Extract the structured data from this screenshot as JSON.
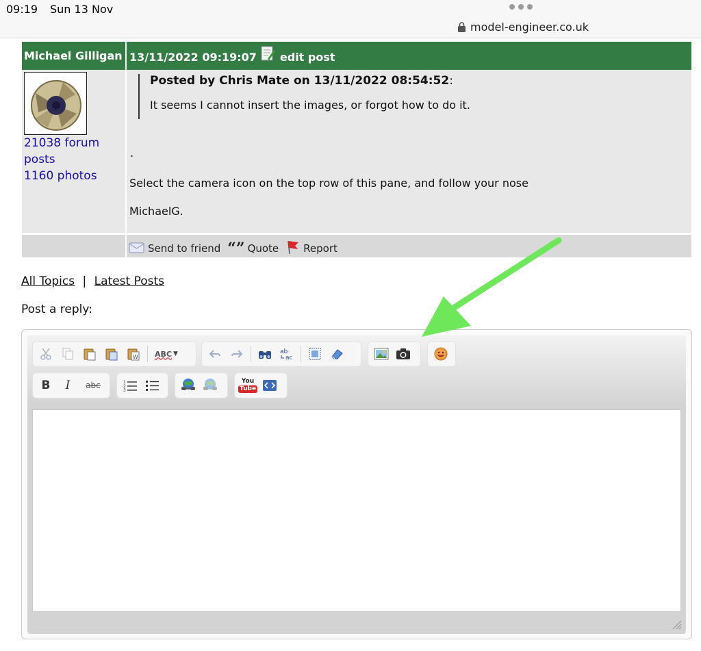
{
  "status": {
    "time": "09:19",
    "date": "Sun 13 Nov",
    "url": "model-engineer.co.uk"
  },
  "post": {
    "author": "Michael Gilligan",
    "timestamp": "13/11/2022 09:19:07",
    "edit_label": "edit post",
    "forum_posts": "21038 forum posts",
    "photos": "1160 photos",
    "quote_by": "Posted by Chris Mate on 13/11/2022 08:54:52",
    "quote_colon": ":",
    "quote_text": "It seems I cannot insert the images, or forgot how to do it.",
    "dot": ".",
    "reply_line1": "Select the camera icon on the top row of this pane, and follow your nose",
    "reply_line2": "MichaelG.",
    "actions": {
      "send": "Send to friend",
      "quote": "Quote",
      "report": "Report"
    }
  },
  "links": {
    "all_topics": "All Topics",
    "separator": "|",
    "latest_posts": "Latest Posts"
  },
  "reply_label": "Post a reply:",
  "editor": {
    "toolbar_row1": [
      "cut-icon",
      "copy-icon",
      "paste-icon",
      "paste-text-icon",
      "paste-word-icon",
      "spellcheck-icon",
      "undo-icon",
      "redo-icon",
      "find-icon",
      "replace-icon",
      "select-all-icon",
      "remove-format-icon",
      "image-icon",
      "camera-icon",
      "smiley-icon"
    ],
    "toolbar_row2": [
      "bold-icon",
      "italic-icon",
      "strikethrough-icon",
      "numbered-list-icon",
      "bulleted-list-icon",
      "link-icon",
      "unlink-icon",
      "youtube-icon",
      "embed-code-icon"
    ],
    "spell_label": "ABC",
    "bold": "B",
    "italic": "I",
    "strike": "abc",
    "youtube_you": "You",
    "youtube_tube": "Tube"
  },
  "colors": {
    "header_green": "#337d44",
    "arrow_green": "#6ee85a",
    "link_blue": "#1a0dab"
  }
}
